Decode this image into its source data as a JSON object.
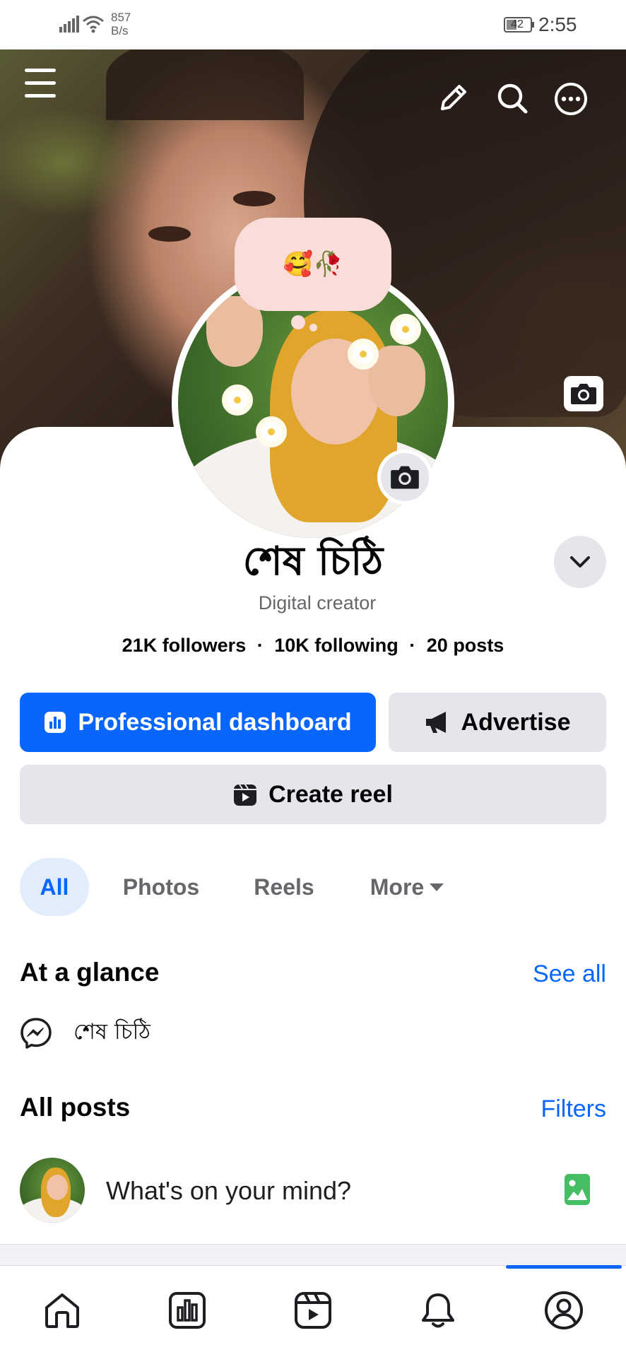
{
  "status_bar": {
    "net_speed_value": "857",
    "net_speed_unit": "B/s",
    "battery_level": "42",
    "time": "2:55"
  },
  "profile": {
    "note_emoji": "🥰🥀",
    "name": "শেষ চিঠি",
    "category": "Digital creator",
    "followers": "21K followers",
    "following": "10K following",
    "posts": "20 posts",
    "separator": "·"
  },
  "actions": {
    "dashboard_label": "Professional dashboard",
    "advertise_label": "Advertise",
    "create_reel_label": "Create reel"
  },
  "tabs": [
    {
      "label": "All",
      "active": true
    },
    {
      "label": "Photos",
      "active": false
    },
    {
      "label": "Reels",
      "active": false
    },
    {
      "label": "More",
      "active": false
    }
  ],
  "glance": {
    "title": "At a glance",
    "link": "See all",
    "messenger_name": "শেষ চিঠি"
  },
  "posts_section": {
    "title": "All posts",
    "link": "Filters",
    "composer_placeholder": "What's on your mind?"
  },
  "bottom_nav": {
    "items": [
      "home-icon",
      "dashboard-icon",
      "reels-icon",
      "notifications-icon",
      "profile-icon"
    ],
    "active": "profile-icon"
  },
  "colors": {
    "accent": "#0866ff",
    "button_gray": "#e4e6eb",
    "secondary_text": "#65676b",
    "note_bubble": "#fadcd9",
    "photo_icon_green": "#45bd62"
  }
}
